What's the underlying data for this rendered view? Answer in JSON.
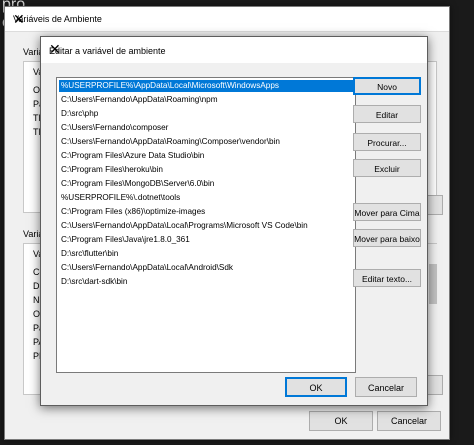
{
  "background": {
    "fragments": [
      "pro",
      "c"
    ]
  },
  "back_window": {
    "title": "Variáveis de Ambiente",
    "close": "✕",
    "user_section_label": "Variá",
    "user_vars_stub": [
      "Va",
      "On",
      "Pa",
      "TE",
      "TN"
    ],
    "system_section_label": "Variá",
    "system_vars_stub": [
      "Va",
      "Co",
      "Dr",
      "NU",
      "OS",
      "Pa",
      "PA",
      "PR"
    ],
    "ok_label": "OK",
    "cancel_label": "Cancelar"
  },
  "dialog": {
    "title": "Editar a variável de ambiente",
    "close": "✕",
    "entries": [
      "%USERPROFILE%\\AppData\\Local\\Microsoft\\WindowsApps",
      "C:\\Users\\Fernando\\AppData\\Roaming\\npm",
      "D:\\src\\php",
      "C:\\Users\\Fernando\\composer",
      "C:\\Users\\Fernando\\AppData\\Roaming\\Composer\\vendor\\bin",
      "C:\\Program Files\\Azure Data Studio\\bin",
      "C:\\Program Files\\heroku\\bin",
      "C:\\Program Files\\MongoDB\\Server\\6.0\\bin",
      "%USERPROFILE%\\.dotnet\\tools",
      "C:\\Program Files (x86)\\optimize-images",
      "C:\\Users\\Fernando\\AppData\\Local\\Programs\\Microsoft VS Code\\bin",
      "C:\\Program Files\\Java\\jre1.8.0_361",
      "D:\\src\\flutter\\bin",
      "C:\\Users\\Fernando\\AppData\\Local\\Android\\Sdk",
      "D:\\src\\dart-sdk\\bin"
    ],
    "selected_index": 0,
    "buttons": {
      "novo": "Novo",
      "editar": "Editar",
      "procurar": "Procurar...",
      "excluir": "Excluir",
      "mover_cima": "Mover para Cima",
      "mover_baixo": "Mover para baixo",
      "editar_texto": "Editar texto..."
    },
    "ok_label": "OK",
    "cancel_label": "Cancelar"
  }
}
